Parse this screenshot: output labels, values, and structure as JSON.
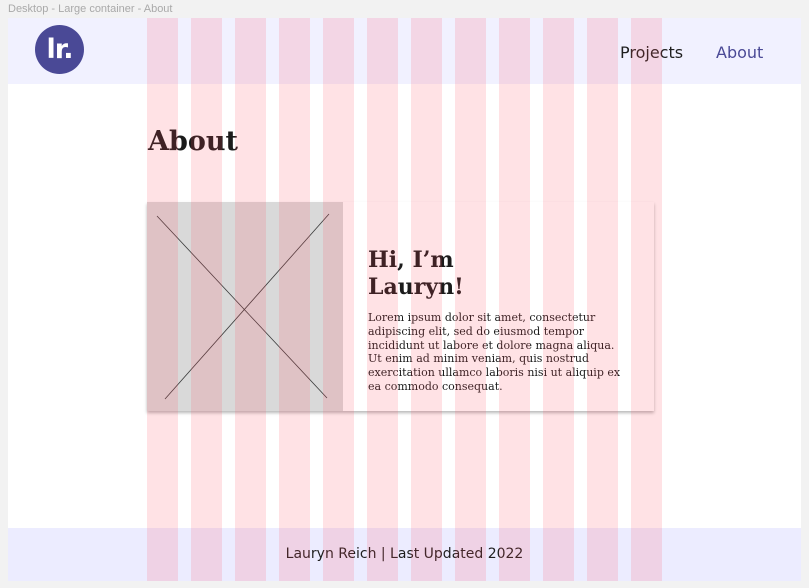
{
  "frame": {
    "label": "Desktop - Large container - About"
  },
  "navbar": {
    "logo_text": "lr.",
    "links": [
      "Projects",
      "About"
    ]
  },
  "main": {
    "title": "About",
    "card": {
      "heading_line1": "Hi, I’m",
      "heading_line2": "Lauryn!",
      "body": "Lorem ipsum dolor sit amet, consectetur adipiscing elit, sed do eiusmod tempor incididunt ut labore et dolore magna aliqua. Ut enim ad minim veniam, quis nostrud exercitation ullamco laboris nisi ut aliquip ex ea commodo consequat."
    }
  },
  "footer": {
    "text": "Lauryn Reich | Last Updated 2022"
  },
  "colors": {
    "brand": "#4a4996",
    "nav_background": "#f1f1ff",
    "footer_background": "#ececff",
    "grid_overlay": "#ff485c"
  },
  "icons": {
    "image_placeholder": "image-placeholder-icon"
  },
  "layout_grid": {
    "columns": 12
  }
}
